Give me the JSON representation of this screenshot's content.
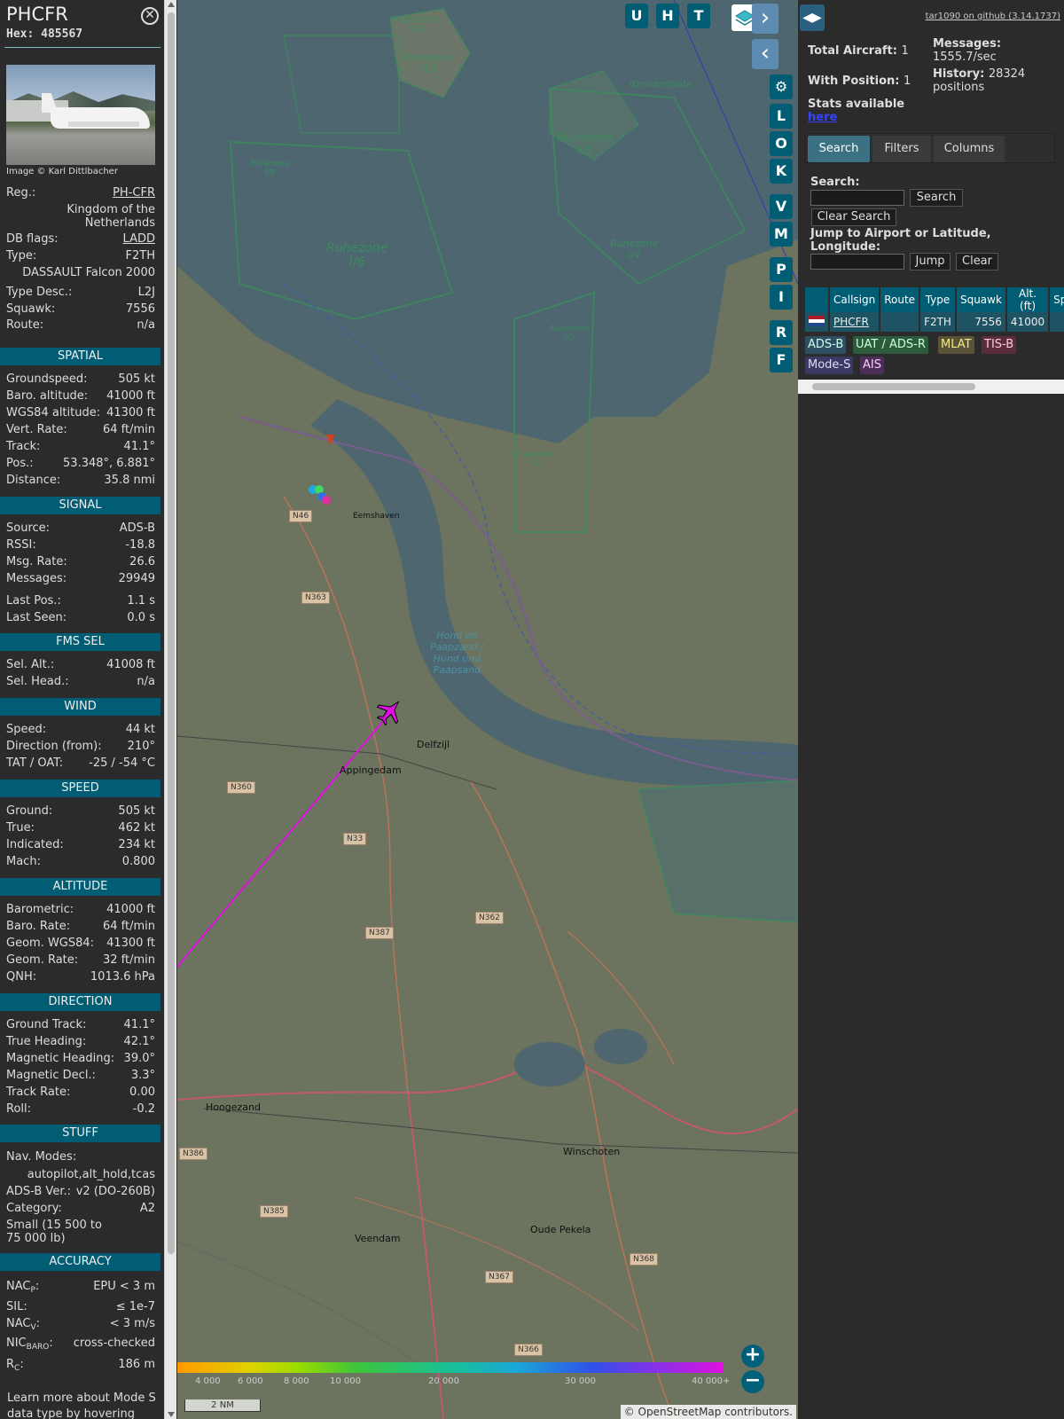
{
  "info": {
    "callsign": "PHCFR",
    "hex_label": "Hex:",
    "hex": "485567",
    "photo_caption": "Image © Karl Dittlbacher",
    "reg_label": "Reg.:",
    "reg": "PH-CFR",
    "country": "Kingdom of the Netherlands",
    "dbflags_label": "DB flags:",
    "dbflags": "LADD",
    "type_label": "Type:",
    "type": "F2TH",
    "type_name": "DASSAULT Falcon 2000",
    "typedesc_label": "Type Desc.:",
    "typedesc": "L2J",
    "squawk_label": "Squawk:",
    "squawk": "7556",
    "route_label": "Route:",
    "route": "n/a"
  },
  "sections": {
    "spatial": {
      "title": "SPATIAL",
      "rows": [
        {
          "label": "Groundspeed:",
          "value": "505 kt"
        },
        {
          "label": "Baro. altitude:",
          "value": "41000 ft"
        },
        {
          "label": "WGS84 altitude:",
          "value": "41300 ft"
        },
        {
          "label": "Vert. Rate:",
          "value": "64 ft/min"
        },
        {
          "label": "Track:",
          "value": "41.1°"
        },
        {
          "label": "Pos.:",
          "value": "53.348°, 6.881°"
        },
        {
          "label": "Distance:",
          "value": "35.8 nmi"
        }
      ]
    },
    "signal": {
      "title": "SIGNAL",
      "rows": [
        {
          "label": "Source:",
          "value": "ADS-B"
        },
        {
          "label": "RSSI:",
          "value": "-18.8"
        },
        {
          "label": "Msg. Rate:",
          "value": "26.6"
        },
        {
          "label": "Messages:",
          "value": "29949"
        },
        {
          "label": "Last Pos.:",
          "value": "1.1 s"
        },
        {
          "label": "Last Seen:",
          "value": "0.0 s"
        }
      ]
    },
    "fms": {
      "title": "FMS SEL",
      "rows": [
        {
          "label": "Sel. Alt.:",
          "value": "41008 ft"
        },
        {
          "label": "Sel. Head.:",
          "value": "n/a"
        }
      ]
    },
    "wind": {
      "title": "WIND",
      "rows": [
        {
          "label": "Speed:",
          "value": "44 kt"
        },
        {
          "label": "Direction (from):",
          "value": "210°"
        },
        {
          "label": "TAT / OAT:",
          "value": "-25 / -54 °C"
        }
      ]
    },
    "speed": {
      "title": "SPEED",
      "rows": [
        {
          "label": "Ground:",
          "value": "505 kt"
        },
        {
          "label": "True:",
          "value": "462 kt"
        },
        {
          "label": "Indicated:",
          "value": "234 kt"
        },
        {
          "label": "Mach:",
          "value": "0.800"
        }
      ]
    },
    "altitude": {
      "title": "ALTITUDE",
      "rows": [
        {
          "label": "Barometric:",
          "value": "41000 ft"
        },
        {
          "label": "Baro. Rate:",
          "value": "64 ft/min"
        },
        {
          "label": "Geom. WGS84:",
          "value": "41300 ft"
        },
        {
          "label": "Geom. Rate:",
          "value": "32 ft/min"
        },
        {
          "label": "QNH:",
          "value": "1013.6 hPa"
        }
      ]
    },
    "direction": {
      "title": "DIRECTION",
      "rows": [
        {
          "label": "Ground Track:",
          "value": "41.1°"
        },
        {
          "label": "True Heading:",
          "value": "42.1°"
        },
        {
          "label": "Magnetic Heading:",
          "value": "39.0°"
        },
        {
          "label": "Magnetic Decl.:",
          "value": "3.3°"
        },
        {
          "label": "Track Rate:",
          "value": "0.00"
        },
        {
          "label": "Roll:",
          "value": "-0.2"
        }
      ]
    },
    "stuff": {
      "title": "STUFF",
      "navmodes_label": "Nav. Modes:",
      "navmodes": "autopilot,alt_hold,tcas",
      "adsbver_label": "ADS-B Ver.:",
      "adsbver": "v2 (DO-260B)",
      "category_label": "Category:",
      "category": "A2",
      "category_desc": "Small (15 500 to 75 000 lb)"
    },
    "accuracy": {
      "title": "ACCURACY",
      "nacp_label": "NAC",
      "nacp_sub": "P",
      "nacp": "EPU < 3 m",
      "sil_label": "SIL:",
      "sil": "≤ 1e-7",
      "nacv_label": "NAC",
      "nacv_sub": "V",
      "nacv": "< 3 m/s",
      "nicbaro_label": "NIC",
      "nicbaro_sub": "BARO",
      "nicbaro": "cross-checked",
      "rc_label": "R",
      "rc_sub": "C",
      "rc": "186 m"
    },
    "footer": "Learn more about Mode S data type by hovering over"
  },
  "map": {
    "buttons_top": [
      "U",
      "H",
      "T"
    ],
    "buttons_side": [
      "L",
      "O",
      "K",
      "V",
      "M",
      "P",
      "I",
      "R",
      "F"
    ],
    "zone_labels": [
      "Ruhezone I/4",
      "Ruhezone I/13",
      "Ruhezone I/5",
      "Ruhezone I/6",
      "Ruhezone I/4",
      "Ruhezone I/8",
      "Ruhezone I/3",
      "Ruhezone I/2"
    ],
    "places": [
      "Delfzijl",
      "Appingedam",
      "Hoogezand",
      "Winschoten",
      "Veendam",
      "Oude Pekela",
      "Eemshaven"
    ],
    "roads": [
      "N46",
      "N363",
      "N360",
      "N33",
      "N387",
      "N362",
      "N386",
      "N385",
      "N367",
      "N368",
      "N366"
    ],
    "scale": "2 NM",
    "attribution": "© OpenStreetMap contributors.",
    "altitude_scale": [
      "4 000",
      "6 000",
      "8 000",
      "10 000",
      "20 000",
      "30 000",
      "40 000+"
    ]
  },
  "right": {
    "github_link": "tar1090 on github (3.14.1737)",
    "total_aircraft_label": "Total Aircraft:",
    "total_aircraft": "1",
    "with_position_label": "With Position:",
    "with_position": "1",
    "messages_label": "Messages:",
    "messages": "1555.7/sec",
    "history_label": "History:",
    "history": "28324 positions",
    "stats_label": "Stats available",
    "stats_link": "here",
    "tabs": [
      "Search",
      "Filters",
      "Columns"
    ],
    "search_label": "Search:",
    "search_button": "Search",
    "clear_search_button": "Clear Search",
    "jump_label": "Jump to Airport or Latitude, Longitude:",
    "jump_button": "Jump",
    "clear_button": "Clear",
    "table_headers": [
      "Callsign",
      "Route",
      "Type",
      "Squawk",
      "Alt. (ft)",
      "Spd."
    ],
    "table_row": {
      "callsign": "PHCFR",
      "route": "",
      "type": "F2TH",
      "squawk": "7556",
      "alt": "41000",
      "spd": ""
    },
    "source_badges": [
      "ADS-B",
      "UAT / ADS-R",
      "MLAT",
      "TIS-B",
      "Mode-S",
      "AIS"
    ]
  }
}
